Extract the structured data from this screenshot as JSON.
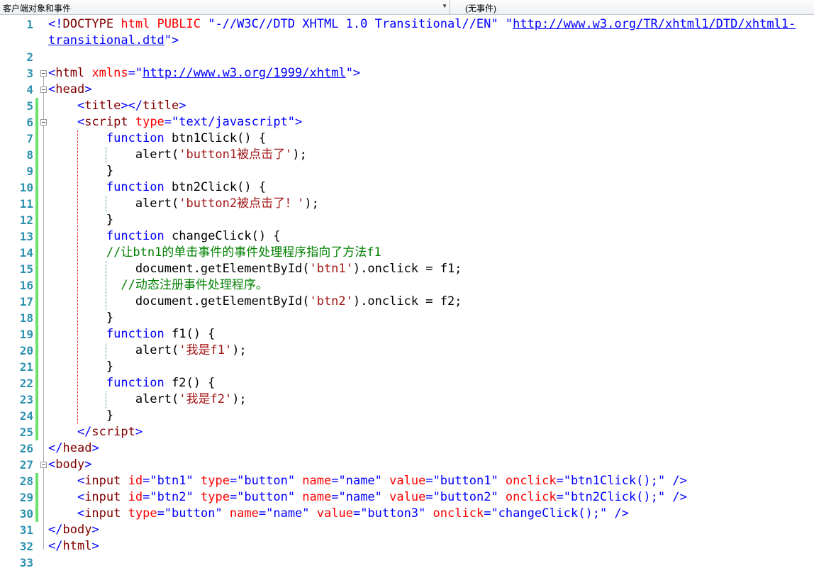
{
  "header": {
    "object_dropdown": "客户端对象和事件",
    "event_dropdown": "(无事件)"
  },
  "colors": {
    "line_number": "#2b91af",
    "change_bar": "#6ce26c",
    "tag": "#0000ff",
    "element": "#800000",
    "attribute": "#ff0000",
    "string": "#a31515",
    "comment": "#008000"
  },
  "lines": [
    {
      "n": "1",
      "tokens": [
        [
          "<!",
          "t"
        ],
        [
          "DOCTYPE ",
          "e"
        ],
        [
          "html PUBLIC ",
          "a"
        ],
        [
          "\"-//W3C//DTD XHTML 1.0 Transitional//EN\" ",
          "v"
        ],
        [
          "\"",
          "v"
        ],
        [
          "http://www.w3.org/TR/xhtml1/DTD/xhtml1-",
          "u"
        ]
      ],
      "wrap": [
        [
          "transitional.dtd",
          "u"
        ],
        [
          "\"",
          "v"
        ],
        [
          ">",
          "t"
        ]
      ]
    },
    {
      "n": "2",
      "tokens": []
    },
    {
      "n": "3",
      "tokens": [
        [
          "<",
          "t"
        ],
        [
          "html ",
          "e"
        ],
        [
          "xmlns",
          "a"
        ],
        [
          "=\"",
          "t"
        ],
        [
          "http://www.w3.org/1999/xhtml",
          "u"
        ],
        [
          "\">",
          "t"
        ]
      ]
    },
    {
      "n": "4",
      "tokens": [
        [
          "<",
          "t"
        ],
        [
          "head",
          "e"
        ],
        [
          ">",
          "t"
        ]
      ]
    },
    {
      "n": "5",
      "tokens": [
        [
          "    <",
          "t"
        ],
        [
          "title",
          "e"
        ],
        [
          "></",
          "t"
        ],
        [
          "title",
          "e"
        ],
        [
          ">",
          "t"
        ]
      ]
    },
    {
      "n": "6",
      "tokens": [
        [
          "    <",
          "t"
        ],
        [
          "script ",
          "e"
        ],
        [
          "type",
          "a"
        ],
        [
          "=\"text/javascript\">",
          "t"
        ]
      ]
    },
    {
      "n": "7",
      "tokens": [
        [
          "        function ",
          "k"
        ],
        [
          "btn1Click() {",
          "p"
        ]
      ]
    },
    {
      "n": "8",
      "tokens": [
        [
          "            alert(",
          "p"
        ],
        [
          "'button1被点击了'",
          "s"
        ],
        [
          ");",
          "p"
        ]
      ]
    },
    {
      "n": "9",
      "tokens": [
        [
          "        }",
          "p"
        ]
      ]
    },
    {
      "n": "10",
      "tokens": [
        [
          "        function ",
          "k"
        ],
        [
          "btn2Click() {",
          "p"
        ]
      ]
    },
    {
      "n": "11",
      "tokens": [
        [
          "            alert(",
          "p"
        ],
        [
          "'button2被点击了！'",
          "s"
        ],
        [
          ");",
          "p"
        ]
      ]
    },
    {
      "n": "12",
      "tokens": [
        [
          "        }",
          "p"
        ]
      ]
    },
    {
      "n": "13",
      "tokens": [
        [
          "        function ",
          "k"
        ],
        [
          "changeClick() {",
          "p"
        ]
      ]
    },
    {
      "n": "14",
      "tokens": [
        [
          "        //让btn1的单击事件的事件处理程序指向了方法f1",
          "c"
        ]
      ]
    },
    {
      "n": "15",
      "tokens": [
        [
          "            document.getElementById(",
          "p"
        ],
        [
          "'btn1'",
          "s"
        ],
        [
          ").onclick = f1;",
          "p"
        ]
      ]
    },
    {
      "n": "16",
      "tokens": [
        [
          "          //动态注册事件处理程序。",
          "c"
        ]
      ]
    },
    {
      "n": "17",
      "tokens": [
        [
          "            document.getElementById(",
          "p"
        ],
        [
          "'btn2'",
          "s"
        ],
        [
          ").onclick = f2;",
          "p"
        ]
      ]
    },
    {
      "n": "18",
      "tokens": [
        [
          "        }",
          "p"
        ]
      ]
    },
    {
      "n": "19",
      "tokens": [
        [
          "        function ",
          "k"
        ],
        [
          "f1() {",
          "p"
        ]
      ]
    },
    {
      "n": "20",
      "tokens": [
        [
          "            alert(",
          "p"
        ],
        [
          "'我是f1'",
          "s"
        ],
        [
          ");",
          "p"
        ]
      ]
    },
    {
      "n": "21",
      "tokens": [
        [
          "        }",
          "p"
        ]
      ]
    },
    {
      "n": "22",
      "tokens": [
        [
          "        function ",
          "k"
        ],
        [
          "f2() {",
          "p"
        ]
      ]
    },
    {
      "n": "23",
      "tokens": [
        [
          "            alert(",
          "p"
        ],
        [
          "'我是f2'",
          "s"
        ],
        [
          ");",
          "p"
        ]
      ]
    },
    {
      "n": "24",
      "tokens": [
        [
          "        }",
          "p"
        ]
      ]
    },
    {
      "n": "25",
      "tokens": [
        [
          "    </",
          "t"
        ],
        [
          "script",
          "e"
        ],
        [
          ">",
          "t"
        ]
      ]
    },
    {
      "n": "26",
      "tokens": [
        [
          "</",
          "t"
        ],
        [
          "head",
          "e"
        ],
        [
          ">",
          "t"
        ]
      ]
    },
    {
      "n": "27",
      "tokens": [
        [
          "<",
          "t"
        ],
        [
          "body",
          "e"
        ],
        [
          ">",
          "t"
        ]
      ]
    },
    {
      "n": "28",
      "tokens": [
        [
          "    <",
          "t"
        ],
        [
          "input ",
          "e"
        ],
        [
          "id",
          "a"
        ],
        [
          "=\"btn1\" ",
          "t"
        ],
        [
          "type",
          "a"
        ],
        [
          "=\"button\" ",
          "t"
        ],
        [
          "name",
          "a"
        ],
        [
          "=\"name\" ",
          "t"
        ],
        [
          "value",
          "a"
        ],
        [
          "=\"button1\" ",
          "t"
        ],
        [
          "onclick",
          "a"
        ],
        [
          "=\"btn1Click();\" />",
          "t"
        ]
      ]
    },
    {
      "n": "29",
      "tokens": [
        [
          "    <",
          "t"
        ],
        [
          "input ",
          "e"
        ],
        [
          "id",
          "a"
        ],
        [
          "=\"btn2\" ",
          "t"
        ],
        [
          "type",
          "a"
        ],
        [
          "=\"button\" ",
          "t"
        ],
        [
          "name",
          "a"
        ],
        [
          "=\"name\" ",
          "t"
        ],
        [
          "value",
          "a"
        ],
        [
          "=\"button2\" ",
          "t"
        ],
        [
          "onclick",
          "a"
        ],
        [
          "=\"btn2Click();\" />",
          "t"
        ]
      ]
    },
    {
      "n": "30",
      "tokens": [
        [
          "    <",
          "t"
        ],
        [
          "input ",
          "e"
        ],
        [
          "type",
          "a"
        ],
        [
          "=\"button\" ",
          "t"
        ],
        [
          "name",
          "a"
        ],
        [
          "=\"name\" ",
          "t"
        ],
        [
          "value",
          "a"
        ],
        [
          "=\"button3\" ",
          "t"
        ],
        [
          "onclick",
          "a"
        ],
        [
          "=\"changeClick();\" />",
          "t"
        ]
      ]
    },
    {
      "n": "31",
      "tokens": [
        [
          "</",
          "t"
        ],
        [
          "body",
          "e"
        ],
        [
          ">",
          "t"
        ]
      ]
    },
    {
      "n": "32",
      "tokens": [
        [
          "</",
          "t"
        ],
        [
          "html",
          "e"
        ],
        [
          ">",
          "t"
        ]
      ]
    },
    {
      "n": "33",
      "tokens": []
    }
  ]
}
